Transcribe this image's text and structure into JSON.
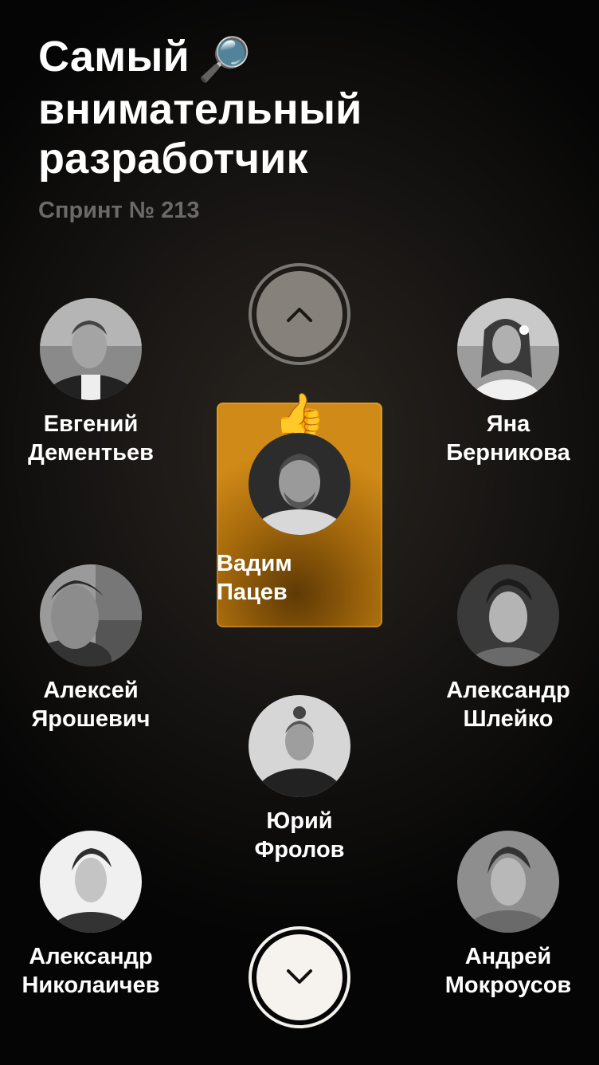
{
  "header": {
    "title_lines": [
      "Самый",
      "внимательный",
      "разработчик"
    ],
    "title_emoji": "🔎",
    "subtitle": "Спринт № 213"
  },
  "navigation": {
    "up_icon": "chevron-up-icon",
    "down_icon": "chevron-down-icon"
  },
  "highlighted": {
    "name_lines": [
      "Вадим",
      "Пацев"
    ],
    "reaction_emoji": "👍",
    "accent_color": "#c47f14"
  },
  "people": [
    {
      "id": "evgeniy",
      "name_lines": [
        "Евгений",
        "Дементьев"
      ]
    },
    {
      "id": "yana",
      "name_lines": [
        "Яна",
        "Берникова"
      ]
    },
    {
      "id": "aleksey",
      "name_lines": [
        "Алексей",
        "Ярошевич"
      ]
    },
    {
      "id": "aleksandr-sh",
      "name_lines": [
        "Александр",
        "Шлейко"
      ]
    },
    {
      "id": "yuriy",
      "name_lines": [
        "Юрий",
        "Фролов"
      ]
    },
    {
      "id": "aleksandr-n",
      "name_lines": [
        "Александр",
        "Николаичев"
      ]
    },
    {
      "id": "andrey",
      "name_lines": [
        "Андрей",
        "Мокроусов"
      ]
    }
  ]
}
